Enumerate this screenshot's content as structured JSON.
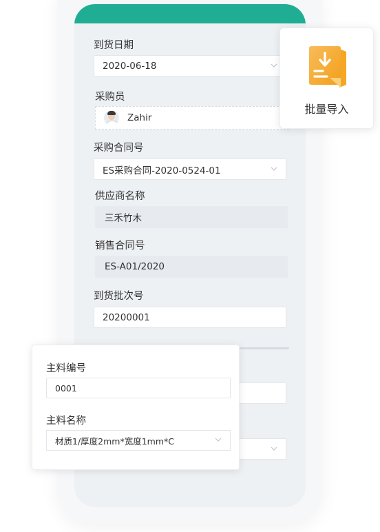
{
  "form": {
    "arrival_date_label": "到货日期",
    "arrival_date_value": "2020-06-18",
    "purchaser_label": "采购员",
    "purchaser_name": "Zahir",
    "purchase_contract_label": "采购合同号",
    "purchase_contract_value": "ES采购合同-2020-0524-01",
    "supplier_label": "供应商名称",
    "supplier_value": "三禾竹木",
    "sales_contract_label": "销售合同号",
    "sales_contract_value": "ES-A01/2020",
    "batch_label": "到货批次号",
    "batch_value": "20200001"
  },
  "import_card": {
    "label": "批量导入",
    "icon": "download-file-icon",
    "icon_color": "#f5a623"
  },
  "material_card": {
    "code_label": "主料编号",
    "code_value": "0001",
    "name_label": "主料名称",
    "name_value": "材质1/厚度2mm*宽度1mm*C"
  },
  "colors": {
    "header": "#1fae94",
    "screen_bg": "#eef1f4",
    "readonly_bg": "#e7eaee"
  }
}
